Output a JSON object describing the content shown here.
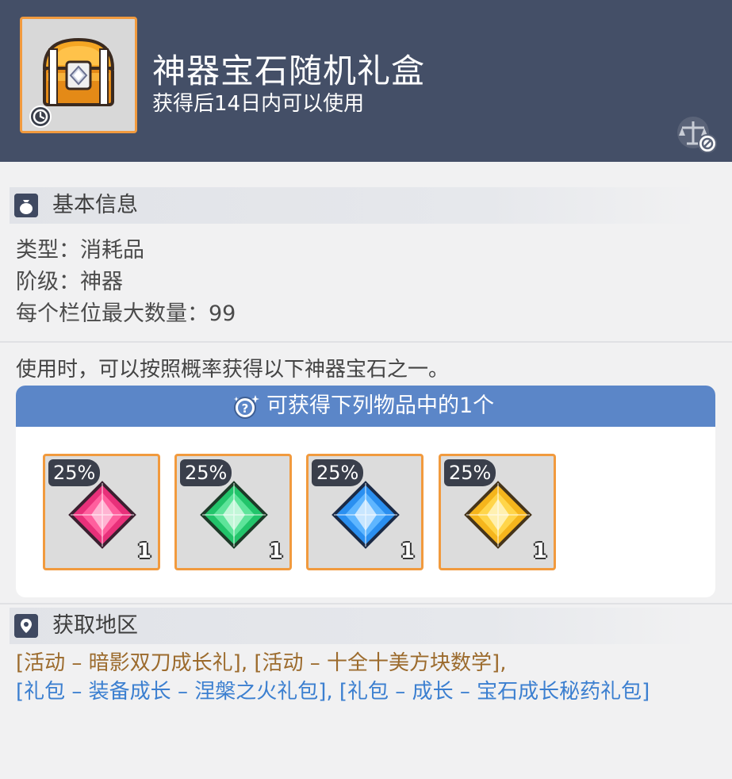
{
  "item": {
    "name": "神器宝石随机礼盒",
    "usage_note": "获得后14日内可以使用",
    "icon": "treasure-chest",
    "badges": [
      "clock-icon",
      "untradeable-scale-icon"
    ]
  },
  "basic_info": {
    "title": "基本信息",
    "icon": "bag-icon",
    "lines": [
      "类型：消耗品",
      "阶级：神器",
      "每个栏位最大数量：99"
    ]
  },
  "description": "使用时，可以按照概率获得以下神器宝石之一。",
  "rewards": {
    "header": "可获得下列物品中的1个",
    "header_icon": "random-box-icon",
    "items": [
      {
        "name": "red-gem",
        "chance": "25%",
        "qty": "1",
        "color": "#e8307a"
      },
      {
        "name": "green-gem",
        "chance": "25%",
        "qty": "1",
        "color": "#22c46a"
      },
      {
        "name": "blue-gem",
        "chance": "25%",
        "qty": "1",
        "color": "#2a8ff0"
      },
      {
        "name": "yellow-gem",
        "chance": "25%",
        "qty": "1",
        "color": "#f5b51c"
      }
    ]
  },
  "acquisition": {
    "title": "获取地区",
    "icon": "location-pin-icon",
    "line1": [
      {
        "text": "[活动 – 暗影双刀成长礼]",
        "color": "#9c6b2d"
      },
      {
        "text": ", ",
        "color": "#9c6b2d"
      },
      {
        "text": "[活动 – 十全十美方块数学]",
        "color": "#9c6b2d"
      },
      {
        "text": ",",
        "color": "#9c6b2d"
      }
    ],
    "line2": [
      {
        "text": "[礼包 – 装备成长 – 涅槃之火礼包]",
        "color": "#3b7fd0"
      },
      {
        "text": ", ",
        "color": "#3b7fd0"
      },
      {
        "text": "[礼包 – 成长 – 宝石成长秘药礼包]",
        "color": "#3b7fd0"
      }
    ]
  },
  "colors": {
    "header_bg": "#444f67",
    "accent_orange": "#f19a3e",
    "reward_header": "#5b86c8"
  }
}
